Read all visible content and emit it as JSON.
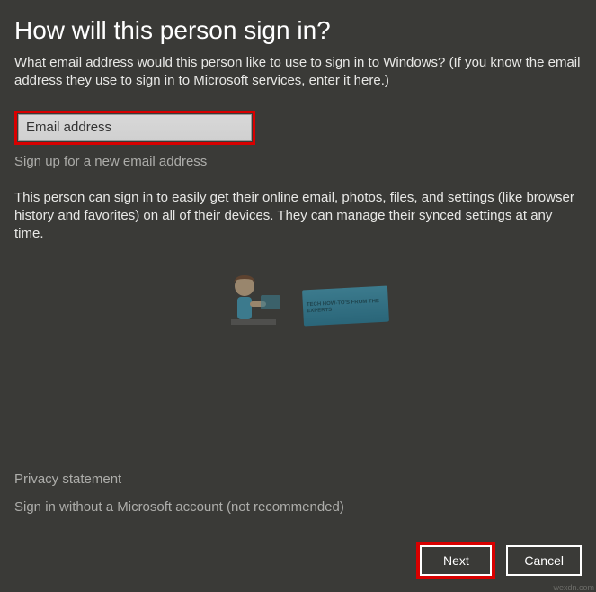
{
  "title": "How will this person sign in?",
  "description": "What email address would this person like to use to sign in to Windows? (If you know the email address they use to sign in to Microsoft services, enter it here.)",
  "emailPlaceholder": "Email address",
  "signUpLink": "Sign up for a new email address",
  "bodyText": "This person can sign in to easily get their online email, photos, files, and settings (like browser history and favorites) on all of their devices. They can manage their synced settings at any time.",
  "privacyLink": "Privacy statement",
  "noMsAccountLink": "Sign in without a Microsoft account (not recommended)",
  "nextButton": "Next",
  "cancelButton": "Cancel",
  "watermarkBadge": "TECH HOW-TO'S FROM THE EXPERTS",
  "sourceText": "wexdn.com"
}
